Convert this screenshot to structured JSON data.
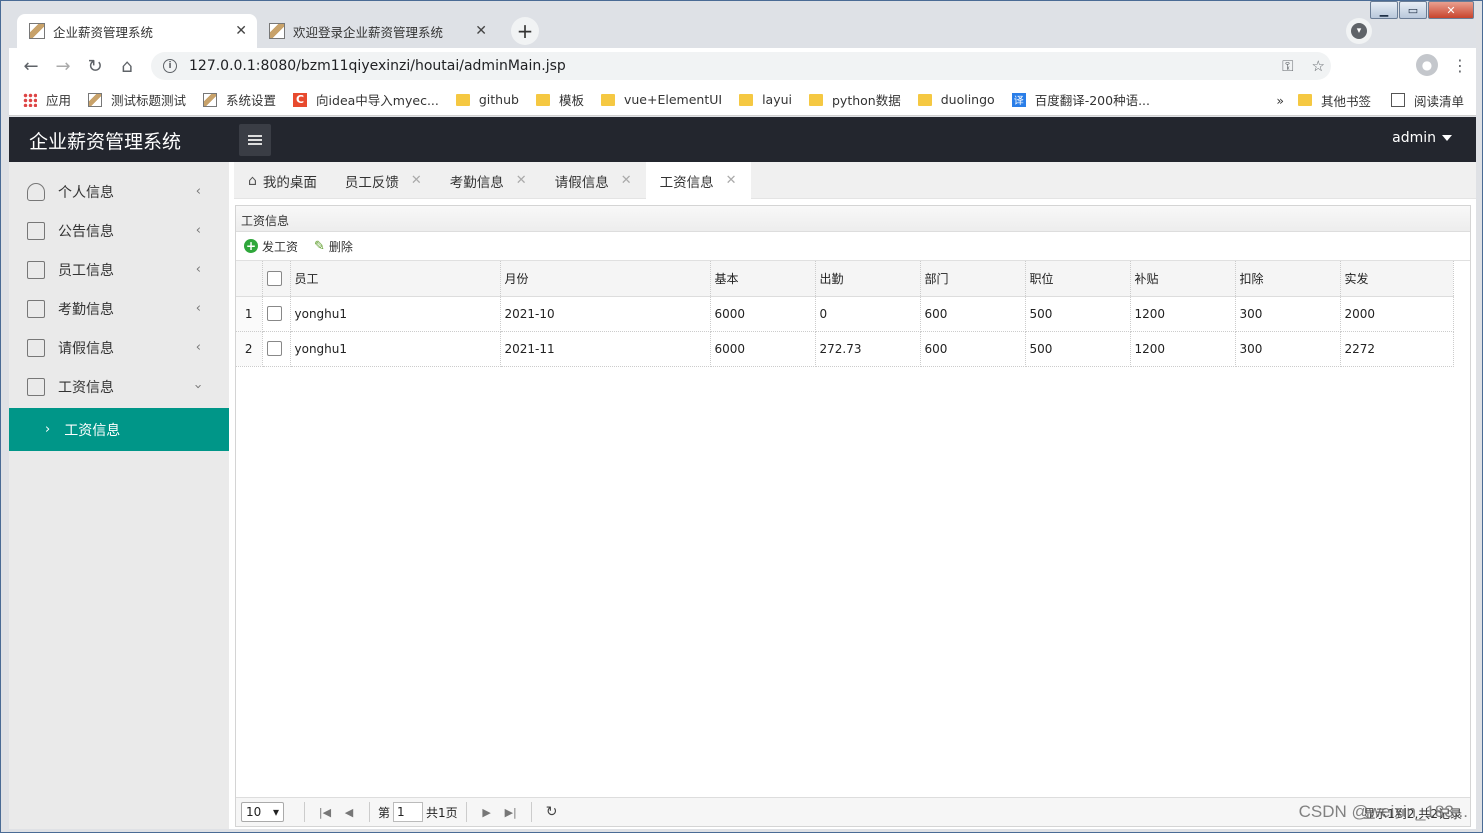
{
  "browser": {
    "tabs": [
      {
        "title": "企业薪资管理系统",
        "active": true
      },
      {
        "title": "欢迎登录企业薪资管理系统",
        "active": false
      }
    ],
    "url": "127.0.0.1:8080/bzm11qiyexinzi/houtai/adminMain.jsp",
    "bookmarks": [
      "应用",
      "测试标题测试",
      "系统设置",
      "向idea中导入myec...",
      "github",
      "模板",
      "vue+ElementUI",
      "layui",
      "python数据",
      "duolingo",
      "百度翻译-200种语..."
    ],
    "bookmarks_right": {
      "more": "»",
      "other": "其他书签",
      "reading": "阅读清单"
    }
  },
  "app": {
    "title": "企业薪资管理系统",
    "user": "admin"
  },
  "sidebar": {
    "items": [
      {
        "label": "个人信息"
      },
      {
        "label": "公告信息"
      },
      {
        "label": "员工信息"
      },
      {
        "label": "考勤信息"
      },
      {
        "label": "请假信息"
      },
      {
        "label": "工资信息"
      }
    ],
    "active_sub": "工资信息"
  },
  "page_tabs": [
    "我的桌面",
    "员工反馈",
    "考勤信息",
    "请假信息",
    "工资信息"
  ],
  "panel": {
    "title": "工资信息",
    "toolbar": {
      "add": "发工资",
      "delete": "删除"
    },
    "columns": [
      "员工",
      "月份",
      "基本",
      "出勤",
      "部门",
      "职位",
      "补贴",
      "扣除",
      "实发"
    ],
    "rows": [
      {
        "n": "1",
        "cells": [
          "yonghu1",
          "2021-10",
          "6000",
          "0",
          "600",
          "500",
          "1200",
          "300",
          "2000"
        ]
      },
      {
        "n": "2",
        "cells": [
          "yonghu1",
          "2021-11",
          "6000",
          "272.73",
          "600",
          "500",
          "1200",
          "300",
          "2272"
        ]
      }
    ]
  },
  "pager": {
    "page_size": "10",
    "page_prefix": "第",
    "page": "1",
    "total_pages": "共1页",
    "info": "显示1到2,共2记录"
  },
  "watermark": "CSDN @weixin_183..."
}
